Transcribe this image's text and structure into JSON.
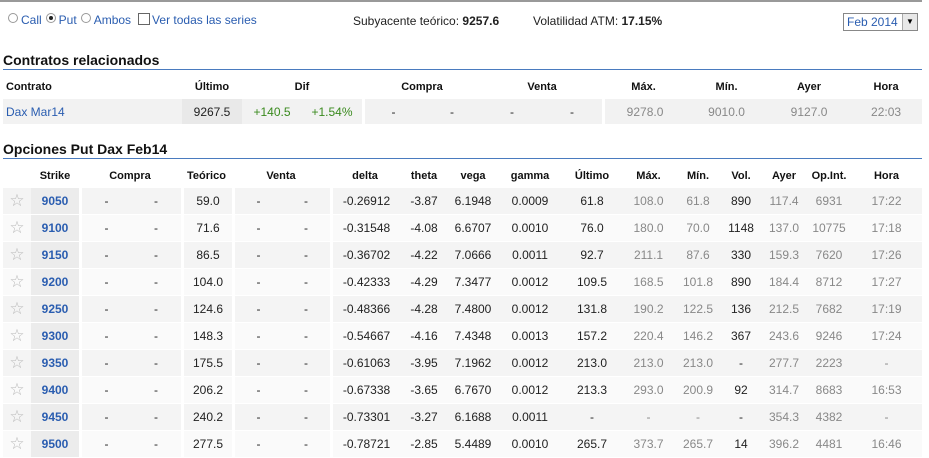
{
  "controls": {
    "call": "Call",
    "put": "Put",
    "ambos": "Ambos",
    "ver_todas": "Ver todas las series",
    "selected": "Put"
  },
  "subyacente": {
    "label": "Subyacente teórico:",
    "value": "9257.6"
  },
  "volatilidad": {
    "label": "Volatilidad ATM:",
    "value": "17.15%"
  },
  "expiry_select": {
    "value": "Feb 2014"
  },
  "related": {
    "title": "Contratos relacionados",
    "headers": [
      "Contrato",
      "Último",
      "Dif",
      "Compra",
      "Venta",
      "Máx.",
      "Mín.",
      "Ayer",
      "Hora"
    ],
    "row": {
      "contrato": "Dax Mar14",
      "ultimo": "9267.5",
      "dif": "+140.5",
      "dif_pct": "+1.54%",
      "compra1": "-",
      "compra2": "-",
      "venta1": "-",
      "venta2": "-",
      "max": "9278.0",
      "min": "9010.0",
      "ayer": "9127.0",
      "hora": "22:03"
    }
  },
  "options": {
    "title": "Opciones Put Dax Feb14",
    "headers": [
      "Strike",
      "Compra",
      "Teórico",
      "Venta",
      "delta",
      "theta",
      "vega",
      "gamma",
      "Último",
      "Máx.",
      "Mín.",
      "Vol.",
      "Ayer",
      "Op.Int.",
      "Hora"
    ],
    "rows": [
      [
        "9050",
        "-",
        "-",
        "59.0",
        "-",
        "-",
        "-0.26912",
        "-3.87",
        "6.1948",
        "0.0009",
        "61.8",
        "108.0",
        "61.8",
        "890",
        "117.4",
        "6931",
        "17:22"
      ],
      [
        "9100",
        "-",
        "-",
        "71.6",
        "-",
        "-",
        "-0.31548",
        "-4.08",
        "6.6707",
        "0.0010",
        "76.0",
        "180.0",
        "70.0",
        "1148",
        "137.0",
        "10775",
        "17:18"
      ],
      [
        "9150",
        "-",
        "-",
        "86.5",
        "-",
        "-",
        "-0.36702",
        "-4.22",
        "7.0666",
        "0.0011",
        "92.7",
        "211.1",
        "87.6",
        "330",
        "159.3",
        "7620",
        "17:26"
      ],
      [
        "9200",
        "-",
        "-",
        "104.0",
        "-",
        "-",
        "-0.42333",
        "-4.29",
        "7.3477",
        "0.0012",
        "109.5",
        "168.5",
        "101.8",
        "890",
        "184.4",
        "8712",
        "17:27"
      ],
      [
        "9250",
        "-",
        "-",
        "124.6",
        "-",
        "-",
        "-0.48366",
        "-4.28",
        "7.4800",
        "0.0012",
        "131.8",
        "190.2",
        "122.5",
        "136",
        "212.5",
        "7682",
        "17:19"
      ],
      [
        "9300",
        "-",
        "-",
        "148.3",
        "-",
        "-",
        "-0.54667",
        "-4.16",
        "7.4348",
        "0.0013",
        "157.2",
        "220.4",
        "146.2",
        "367",
        "243.6",
        "9246",
        "17:24"
      ],
      [
        "9350",
        "-",
        "-",
        "175.5",
        "-",
        "-",
        "-0.61063",
        "-3.95",
        "7.1962",
        "0.0012",
        "213.0",
        "213.0",
        "213.0",
        "-",
        "277.7",
        "2223",
        "-"
      ],
      [
        "9400",
        "-",
        "-",
        "206.2",
        "-",
        "-",
        "-0.67338",
        "-3.65",
        "6.7670",
        "0.0012",
        "213.3",
        "293.0",
        "200.9",
        "92",
        "314.7",
        "8683",
        "16:53"
      ],
      [
        "9450",
        "-",
        "-",
        "240.2",
        "-",
        "-",
        "-0.73301",
        "-3.27",
        "6.1688",
        "0.0011",
        "-",
        "-",
        "-",
        "-",
        "354.3",
        "4382",
        "-"
      ],
      [
        "9500",
        "-",
        "-",
        "277.5",
        "-",
        "-",
        "-0.78721",
        "-2.85",
        "5.4489",
        "0.0010",
        "265.7",
        "373.7",
        "265.7",
        "14",
        "396.2",
        "4481",
        "16:46"
      ]
    ]
  }
}
